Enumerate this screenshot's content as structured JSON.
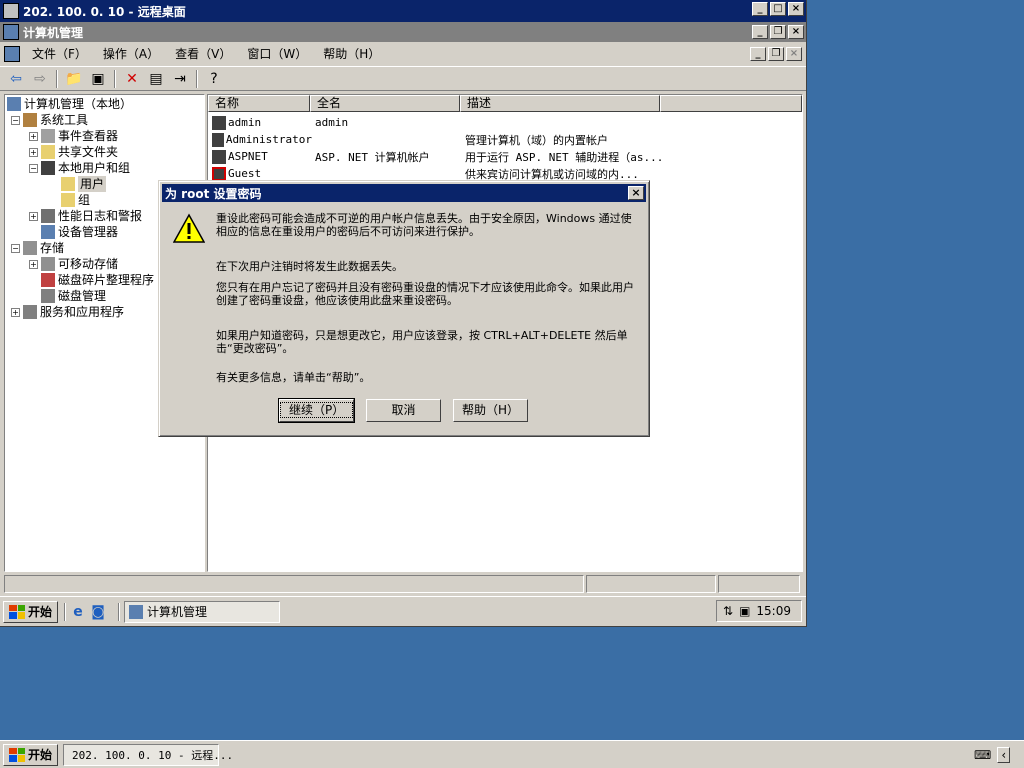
{
  "rdp": {
    "title": "202. 100. 0. 10 - 远程桌面"
  },
  "cm": {
    "title": "计算机管理"
  },
  "menu": [
    "文件（F）",
    "操作（A）",
    "查看（V）",
    "窗口（W）",
    "帮助（H）"
  ],
  "tree": {
    "root": "计算机管理（本地）",
    "items": [
      "系统工具",
      "事件查看器",
      "共享文件夹",
      "本地用户和组",
      "用户",
      "组",
      "性能日志和警报",
      "设备管理器",
      "存储",
      "可移动存储",
      "磁盘碎片整理程序",
      "磁盘管理",
      "服务和应用程序"
    ]
  },
  "list": {
    "headers": [
      "名称",
      "全名",
      "描述"
    ],
    "rows": [
      {
        "name": "admin",
        "full": "admin",
        "desc": ""
      },
      {
        "name": "Administrator",
        "full": "",
        "desc": "管理计算机（域）的内置帐户"
      },
      {
        "name": "ASPNET",
        "full": "ASP. NET 计算机帐户",
        "desc": "用于运行 ASP. NET 辅助进程（as..."
      },
      {
        "name": "Guest",
        "full": "",
        "desc": "供来宾访问计算机或访问域的内..."
      }
    ]
  },
  "dialog": {
    "title": "为 root 设置密码",
    "p1": "重设此密码可能会造成不可逆的用户帐户信息丢失。由于安全原因，Windows 通过使相应的信息在重设用户的密码后不可访问来进行保护。",
    "p2": "在下次用户注销时将发生此数据丢失。",
    "p3": "您只有在用户忘记了密码并且没有密码重设盘的情况下才应该使用此命令。如果此用户创建了密码重设盘，他应该使用此盘来重设密码。",
    "p4": "如果用户知道密码，只是想更改它，用户应该登录，按 CTRL+ALT+DELETE 然后单击“更改密码”。",
    "p5": "有关更多信息，请单击“帮助”。",
    "continue": "继续（P）",
    "cancel": "取消",
    "help": "帮助（H）"
  },
  "inner_taskbar": {
    "start": "开始",
    "task": "计算机管理",
    "clock": "15:09"
  },
  "outer_taskbar": {
    "start": "开始",
    "task": "202. 100. 0. 10 - 远程..."
  }
}
